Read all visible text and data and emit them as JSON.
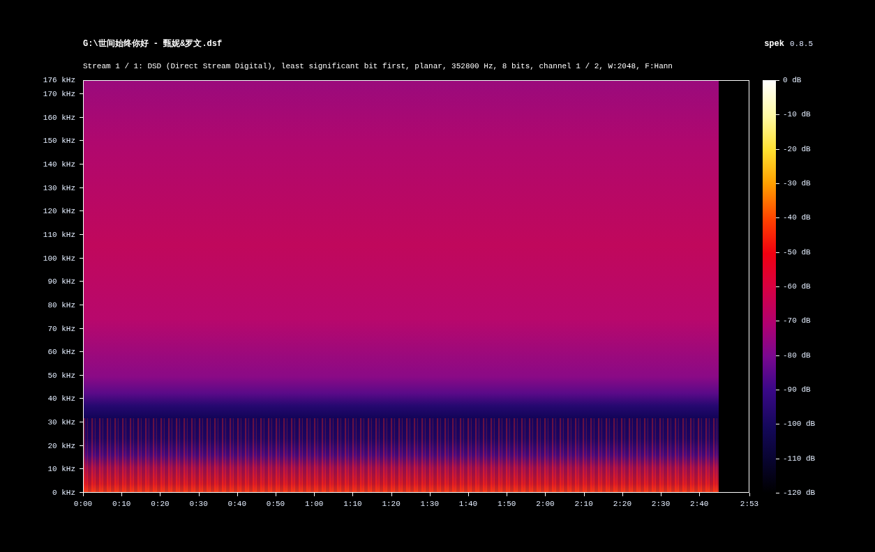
{
  "header": {
    "title": "G:\\世间始终你好 - 甄妮&罗文.dsf",
    "app_name": "spek",
    "version": "0.8.5",
    "stream_info": "Stream 1 / 1: DSD (Direct Stream Digital), least significant bit first, planar, 352800 Hz, 8 bits, channel 1 / 2, W:2048, F:Hann"
  },
  "frequency_axis": {
    "ticks": [
      "176 kHz",
      "170 kHz",
      "160 kHz",
      "150 kHz",
      "140 kHz",
      "130 kHz",
      "120 kHz",
      "110 kHz",
      "100 kHz",
      "90 kHz",
      "80 kHz",
      "70 kHz",
      "60 kHz",
      "50 kHz",
      "40 kHz",
      "30 kHz",
      "20 kHz",
      "10 kHz",
      "0 kHz"
    ]
  },
  "time_axis": {
    "ticks": [
      "0:00",
      "0:10",
      "0:20",
      "0:30",
      "0:40",
      "0:50",
      "1:00",
      "1:10",
      "1:20",
      "1:30",
      "1:40",
      "1:50",
      "2:00",
      "2:10",
      "2:20",
      "2:30",
      "2:40"
    ],
    "end_label": "2:53"
  },
  "db_scale": {
    "ticks": [
      "0 dB",
      "-10 dB",
      "-20 dB",
      "-30 dB",
      "-40 dB",
      "-50 dB",
      "-60 dB",
      "-70 dB",
      "-80 dB",
      "-90 dB",
      "-100 dB",
      "-110 dB",
      "-120 dB"
    ]
  }
}
